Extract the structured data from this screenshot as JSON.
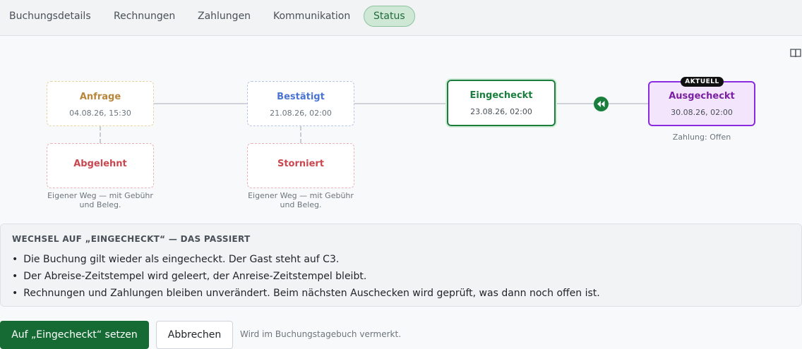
{
  "tabs": [
    {
      "label": "Buchungsdetails"
    },
    {
      "label": "Rechnungen"
    },
    {
      "label": "Zahlungen"
    },
    {
      "label": "Kommunikation"
    },
    {
      "label": "Status",
      "active": true
    }
  ],
  "icons": {
    "docs": "book-icon",
    "back": "rewind-icon"
  },
  "workflow": {
    "anfrage": {
      "label": "Anfrage",
      "date": "04.08.26, 15:30"
    },
    "bestaetigt": {
      "label": "Bestätigt",
      "date": "21.08.26, 02:00"
    },
    "eingecheckt": {
      "label": "Eingecheckt",
      "date": "23.08.26, 02:00"
    },
    "ausgecheckt": {
      "label": "Ausgecheckt",
      "date": "30.08.26, 02:00",
      "badge": "AKTUELL",
      "note": "Zahlung: Offen"
    },
    "abgelehnt": {
      "label": "Abgelehnt",
      "note_line1": "Eigener Weg — mit Gebühr",
      "note_line2": "und Beleg."
    },
    "storniert": {
      "label": "Storniert",
      "note_line1": "Eigener Weg — mit Gebühr",
      "note_line2": "und Beleg."
    }
  },
  "info": {
    "title": "WECHSEL AUF „EINGECHECKT“ — DAS PASSIERT",
    "items": [
      "Die Buchung gilt wieder als eingecheckt. Der Gast steht auf C3.",
      "Der Abreise-Zeitstempel wird geleert, der Anreise-Zeitstempel bleibt.",
      "Rechnungen und Zahlungen bleiben unverändert. Beim nächsten Auschecken wird geprüft, was dann noch offen ist."
    ]
  },
  "actions": {
    "primary_label": "Auf „Eingecheckt“ setzen",
    "cancel_label": "Abbrechen",
    "hint": "Wird im Buchungstagebuch vermerkt."
  },
  "colors": {
    "primary": "#166b34",
    "current": "#8a2be2",
    "selected": "#1a7f3c",
    "rejected": "#c9474f",
    "pending": "#b8863b",
    "confirmed": "#4a74d4"
  }
}
